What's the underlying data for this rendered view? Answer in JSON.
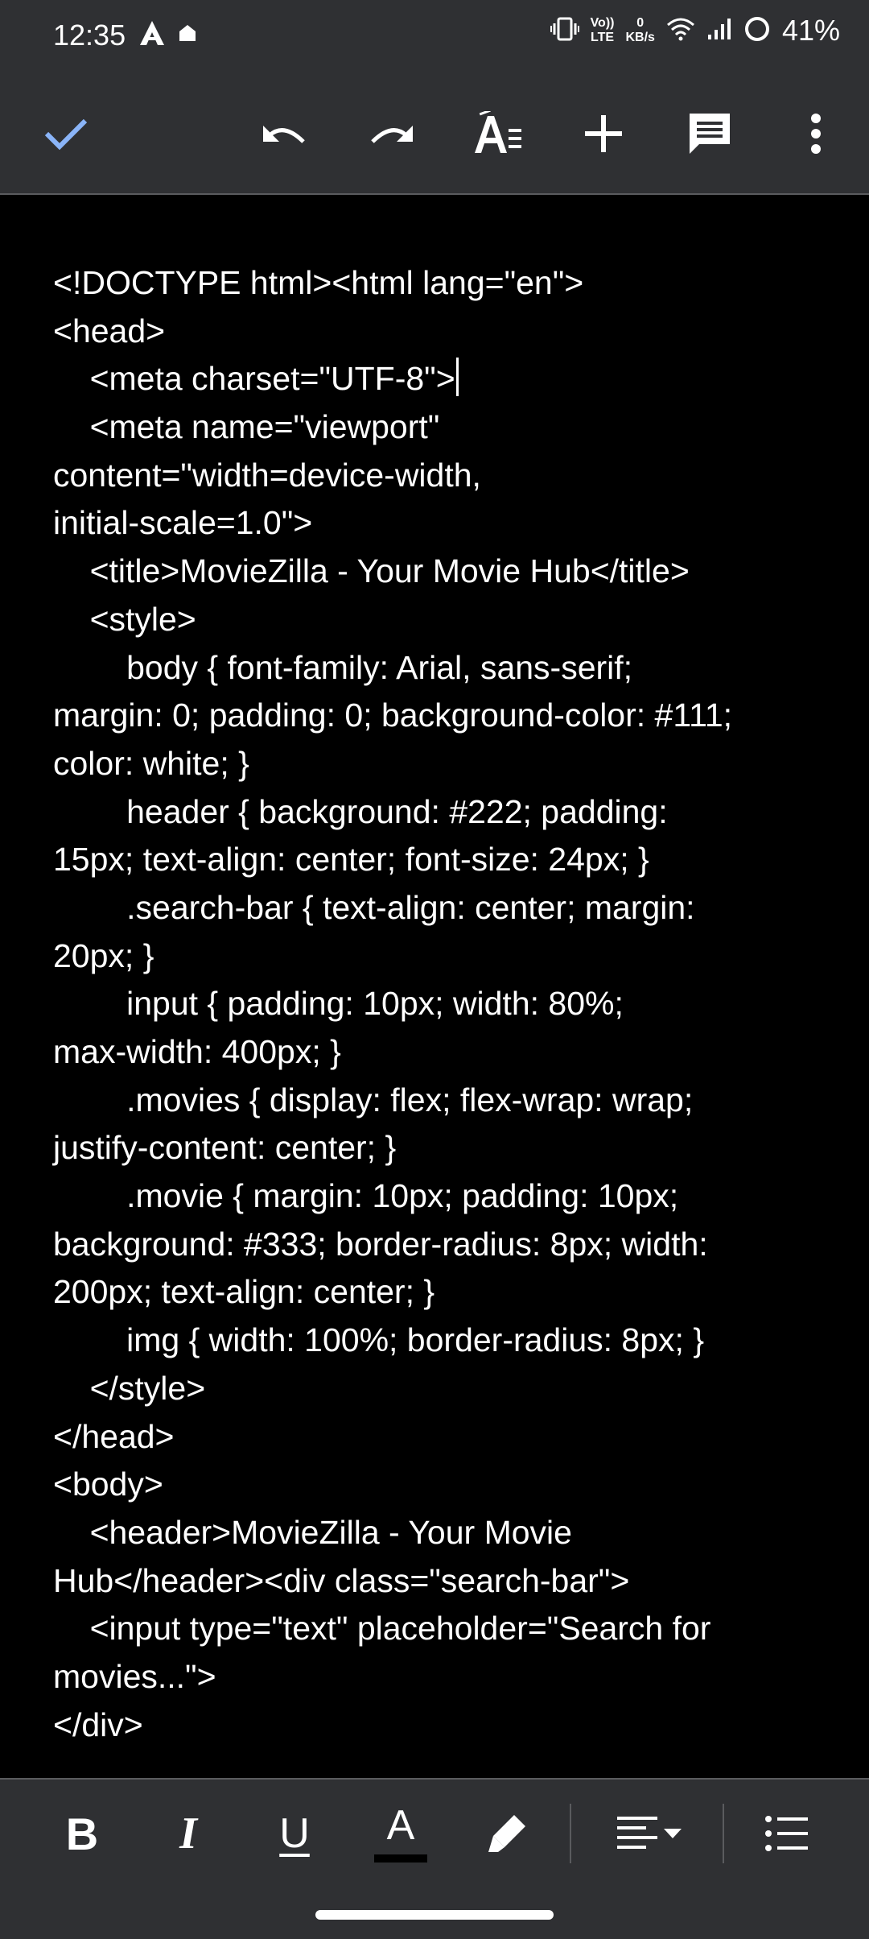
{
  "status_bar": {
    "time": "12:35",
    "net_speed_value": "0",
    "net_speed_unit": "KB/s",
    "volte_top": "Vo))",
    "volte_bottom": "LTE",
    "battery": "41%"
  },
  "toolbar": {
    "icons": [
      "check-icon",
      "undo-icon",
      "redo-icon",
      "text-format-icon",
      "add-icon",
      "comment-icon",
      "more-vert-icon"
    ]
  },
  "document": {
    "lines": [
      "<!DOCTYPE html><html lang=\"en\">",
      "<head>",
      "    <meta charset=\"UTF-8\">",
      "    <meta name=\"viewport\"",
      "content=\"width=device-width,",
      "initial-scale=1.0\">",
      "    <title>MovieZilla - Your Movie Hub</title>",
      "    <style>",
      "        body { font-family: Arial, sans-serif;",
      "margin: 0; padding: 0; background-color: #111;",
      "color: white; }",
      "        header { background: #222; padding:",
      "15px; text-align: center; font-size: 24px; }",
      "        .search-bar { text-align: center; margin:",
      "20px; }",
      "        input { padding: 10px; width: 80%;",
      "max-width: 400px; }",
      "        .movies { display: flex; flex-wrap: wrap;",
      "justify-content: center; }",
      "        .movie { margin: 10px; padding: 10px;",
      "background: #333; border-radius: 8px; width:",
      "200px; text-align: center; }",
      "        img { width: 100%; border-radius: 8px; }",
      "    </style>",
      "</head>",
      "<body>",
      "    <header>MovieZilla - Your Movie",
      "Hub</header><div class=\"search-bar\">",
      "    <input type=\"text\" placeholder=\"Search for",
      "movies...\">",
      "</div>"
    ]
  },
  "format_bar": {
    "bold_label": "B",
    "italic_label": "I",
    "underline_label": "U",
    "text_color_label": "A"
  },
  "colors": {
    "chrome_background": "#2f3033",
    "document_background": "#000000",
    "accent_blue": "#8ab4f8",
    "text": "#ffffff"
  }
}
